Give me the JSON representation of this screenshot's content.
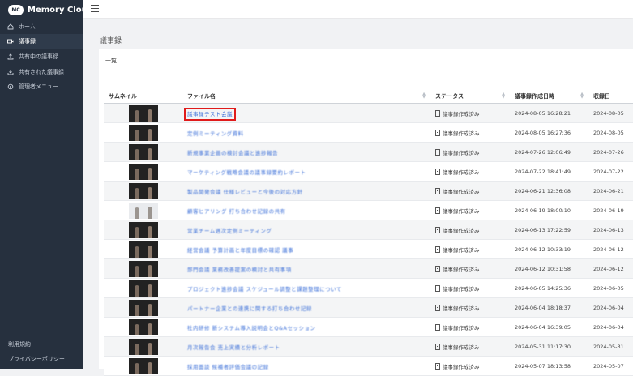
{
  "app": {
    "title": "Memory Cloud",
    "logo_text": "MC"
  },
  "sidebar": {
    "items": [
      {
        "label": "ホーム",
        "icon": "home-icon"
      },
      {
        "label": "議事録",
        "icon": "video-icon"
      },
      {
        "label": "共有中の議事録",
        "icon": "share-icon"
      },
      {
        "label": "共有された議事録",
        "icon": "shared-icon"
      },
      {
        "label": "管理者メニュー",
        "icon": "gear-icon"
      }
    ],
    "active_index": 1,
    "footer": {
      "terms": "利用規約",
      "privacy": "プライバシーポリシー"
    }
  },
  "page": {
    "title": "議事録",
    "card_title": "一覧"
  },
  "table": {
    "headers": [
      "サムネイル",
      "ファイル名",
      "ステータス",
      "議事録作成日時",
      "収録日"
    ],
    "rows": [
      {
        "file": "議事録テスト会議",
        "status": "議事録作成済み",
        "created": "2024-08-05 16:28:21",
        "recorded": "2024-08-05"
      },
      {
        "file": "定例ミーティング資料",
        "status": "議事録作成済み",
        "created": "2024-08-05 16:27:36",
        "recorded": "2024-08-05"
      },
      {
        "file": "新規事業企画の検討会議と進捗報告",
        "status": "議事録作成済み",
        "created": "2024-07-26 12:06:49",
        "recorded": "2024-07-26"
      },
      {
        "file": "マーケティング戦略会議の議事録要約レポート",
        "status": "議事録作成済み",
        "created": "2024-07-22 18:41:49",
        "recorded": "2024-07-22"
      },
      {
        "file": "製品開発会議 仕様レビューと今後の対応方針",
        "status": "議事録作成済み",
        "created": "2024-06-21 12:36:08",
        "recorded": "2024-06-21"
      },
      {
        "file": "顧客ヒアリング 打ち合わせ記録の共有",
        "status": "議事録作成済み",
        "created": "2024-06-19 18:00:10",
        "recorded": "2024-06-19"
      },
      {
        "file": "営業チーム週次定例ミーティング",
        "status": "議事録作成済み",
        "created": "2024-06-13 17:22:59",
        "recorded": "2024-06-13"
      },
      {
        "file": "経営会議 予算計画と年度目標の確認 議事",
        "status": "議事録作成済み",
        "created": "2024-06-12 10:33:19",
        "recorded": "2024-06-12"
      },
      {
        "file": "部門会議 業務改善提案の検討と共有事項",
        "status": "議事録作成済み",
        "created": "2024-06-12 10:31:58",
        "recorded": "2024-06-12"
      },
      {
        "file": "プロジェクト進捗会議 スケジュール調整と課題整理について",
        "status": "議事録作成済み",
        "created": "2024-06-05 14:25:36",
        "recorded": "2024-06-05"
      },
      {
        "file": "パートナー企業との連携に関する打ち合わせ記録",
        "status": "議事録作成済み",
        "created": "2024-06-04 18:18:37",
        "recorded": "2024-06-04"
      },
      {
        "file": "社内研修 新システム導入説明会とQ&Aセッション",
        "status": "議事録作成済み",
        "created": "2024-06-04 16:39:05",
        "recorded": "2024-06-04"
      },
      {
        "file": "月次報告会 売上実績と分析レポート",
        "status": "議事録作成済み",
        "created": "2024-05-31 11:17:30",
        "recorded": "2024-05-31"
      },
      {
        "file": "採用面談 候補者評価会議の記録",
        "status": "議事録作成済み",
        "created": "2024-05-07 18:13:58",
        "recorded": "2024-05-07"
      }
    ]
  }
}
